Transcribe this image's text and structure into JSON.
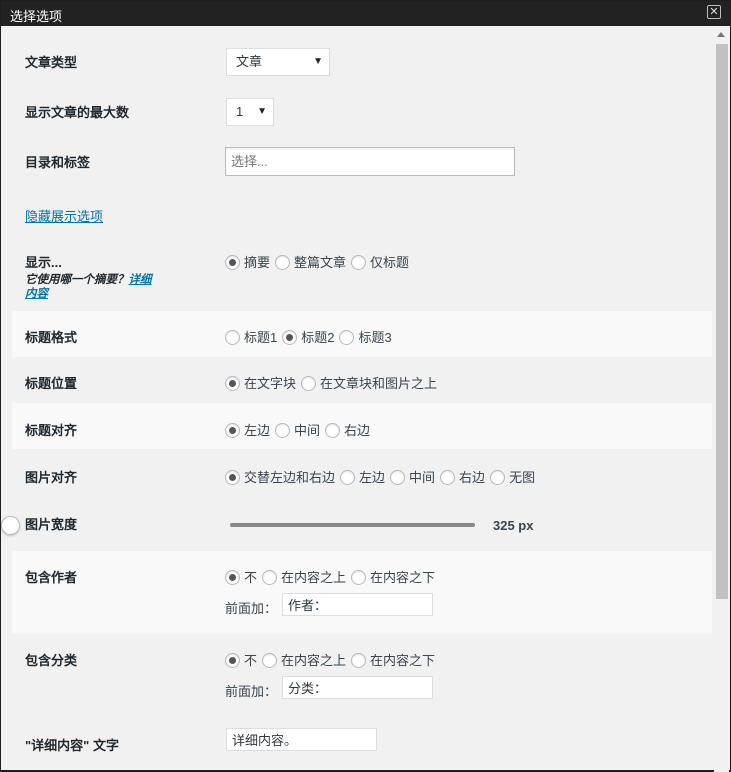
{
  "dialog": {
    "title": "选择选项",
    "close_glyph": "✕"
  },
  "post_type": {
    "label": "文章类型",
    "value": "文章"
  },
  "max_posts": {
    "label": "显示文章的最大数",
    "value": "1"
  },
  "categories_tags": {
    "label": "目录和标签",
    "placeholder": "选择..."
  },
  "toggle_display_link": "隐藏展示选项",
  "display": {
    "label": "显示...",
    "help_prefix": "它使用哪一个摘要？",
    "help_link": "详细内容",
    "options": [
      "摘要",
      "整篇文章",
      "仅标题"
    ],
    "selected": 0
  },
  "title_format": {
    "label": "标题格式",
    "options": [
      "标题1",
      "标题2",
      "标题3"
    ],
    "selected": 1
  },
  "title_position": {
    "label": "标题位置",
    "options": [
      "在文字块",
      "在文章块和图片之上"
    ],
    "selected": 0
  },
  "title_align": {
    "label": "标题对齐",
    "options": [
      "左边",
      "中间",
      "右边"
    ],
    "selected": 0
  },
  "image_align": {
    "label": "图片对齐",
    "options": [
      "交替左边和右边",
      "左边",
      "中间",
      "右边",
      "无图"
    ],
    "selected": 0
  },
  "image_width": {
    "label": "图片宽度",
    "value": "325 px",
    "fraction": 1.0
  },
  "include_author": {
    "label": "包含作者",
    "options": [
      "不",
      "在内容之上",
      "在内容之下"
    ],
    "selected": 0,
    "prefix_label": "前面加：",
    "prefix_value": "作者："
  },
  "include_category": {
    "label": "包含分类",
    "options": [
      "不",
      "在内容之上",
      "在内容之下"
    ],
    "selected": 0,
    "prefix_label": "前面加：",
    "prefix_value": "分类："
  },
  "read_more": {
    "label": "\"详细内容\" 文字",
    "value": "详细内容。"
  }
}
